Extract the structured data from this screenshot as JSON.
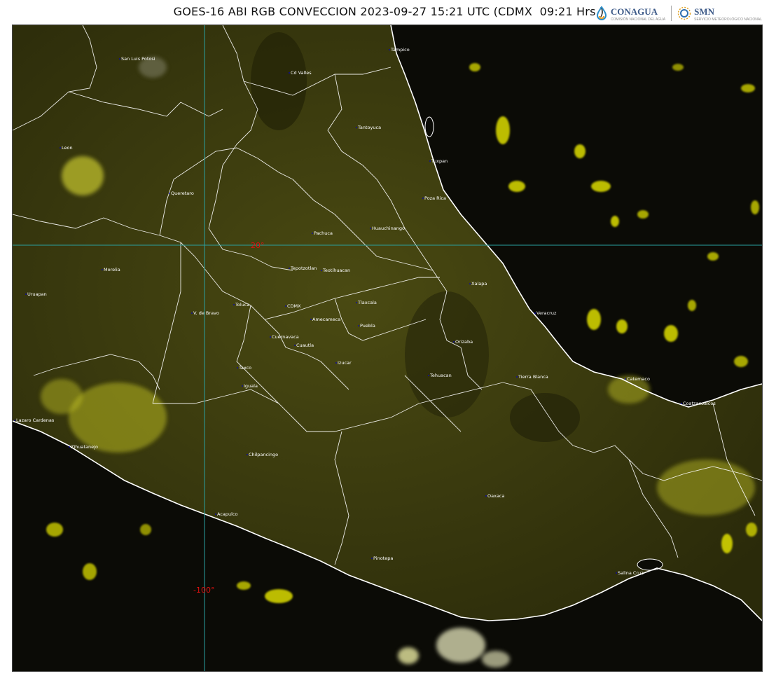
{
  "header": {
    "title": "GOES-16 ABI RGB CONVECCION 2023-09-27 15:21 UTC (CDMX  09:21 Hrs.)",
    "logo_conagua": "CONAGUA",
    "logo_conagua_sub": "COMISIÓN NACIONAL DEL AGUA",
    "logo_smn": "SMN",
    "logo_smn_sub": "SERVICIO METEOROLÓGICO NACIONAL"
  },
  "map": {
    "grid_labels": {
      "lat": "20°",
      "lon": "-100°"
    },
    "colors": {
      "land": "#3a3a10",
      "ocean": "#0a0a05",
      "cloud": "#e8e800",
      "borders": "#ffffff",
      "grid": "#2aa0a0",
      "grid_label": "#e01010"
    },
    "cities": [
      {
        "name": "San Luis Potosi"
      },
      {
        "name": "Cd Valles"
      },
      {
        "name": "Tampico"
      },
      {
        "name": "Leon"
      },
      {
        "name": "Tantoyuca"
      },
      {
        "name": "Tuxpan"
      },
      {
        "name": "Queretaro"
      },
      {
        "name": "Poza Rica"
      },
      {
        "name": "Pachuca"
      },
      {
        "name": "Huauchinango"
      },
      {
        "name": "Morelia"
      },
      {
        "name": "Tepotzotlan"
      },
      {
        "name": "Teotihuacan"
      },
      {
        "name": "Uruapan"
      },
      {
        "name": "Xalapa"
      },
      {
        "name": "Toluca"
      },
      {
        "name": "CDMX"
      },
      {
        "name": "Tlaxcala"
      },
      {
        "name": "V. de Bravo"
      },
      {
        "name": "Amecameca"
      },
      {
        "name": "Puebla"
      },
      {
        "name": "Veracruz"
      },
      {
        "name": "Cuernavaca"
      },
      {
        "name": "Orizaba"
      },
      {
        "name": "Cuautla"
      },
      {
        "name": "Taxco"
      },
      {
        "name": "Izucar"
      },
      {
        "name": "Tierra Blanca"
      },
      {
        "name": "Tehuacan"
      },
      {
        "name": "Catemaco"
      },
      {
        "name": "Iguala"
      },
      {
        "name": "Coatzacoalcos"
      },
      {
        "name": "Lazaro Cardenas"
      },
      {
        "name": "Zihuatanejo"
      },
      {
        "name": "Chilpancingo"
      },
      {
        "name": "Oaxaca"
      },
      {
        "name": "Acapulco"
      },
      {
        "name": "Pinotepa"
      },
      {
        "name": "Salina Cruz"
      }
    ]
  }
}
